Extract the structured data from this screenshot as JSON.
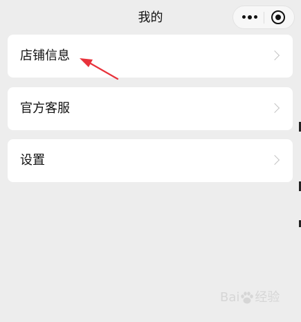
{
  "header": {
    "title": "我的",
    "capsule": {
      "more_icon": "more-dots-icon",
      "close_icon": "mini-program-close-icon"
    }
  },
  "menu": {
    "items": [
      {
        "label": "店铺信息",
        "icon": "chevron-right-icon"
      },
      {
        "label": "官方客服",
        "icon": "chevron-right-icon"
      },
      {
        "label": "设置",
        "icon": "chevron-right-icon"
      }
    ]
  },
  "annotation": {
    "arrow_color": "#e8323b"
  },
  "watermark": {
    "brand": "Bai",
    "suffix": "经验"
  },
  "colors": {
    "background": "#ededed",
    "card": "#ffffff",
    "text": "#111111",
    "chevron": "#c4c4c4"
  }
}
